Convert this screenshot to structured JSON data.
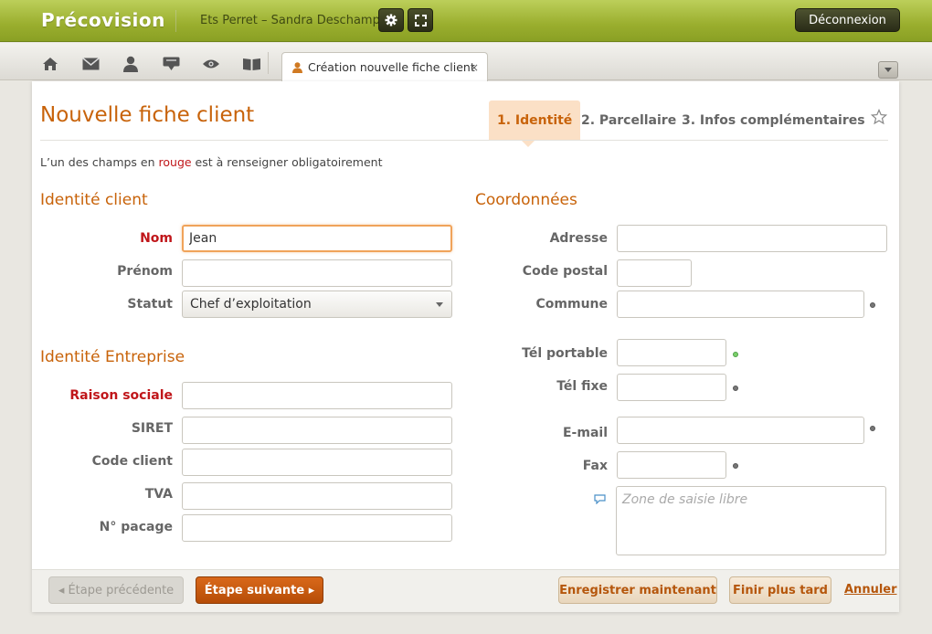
{
  "app": {
    "name": "Précovision",
    "user_context": "Ets Perret – Sandra Deschamps",
    "logout_label": "Déconnexion"
  },
  "topbar": {
    "settings_icon": "gear-icon",
    "fullscreen_icon": "expand-icon"
  },
  "nav": {
    "icons": [
      "home-icon",
      "mail-icon",
      "user-icon",
      "inbox-icon",
      "eye-icon",
      "book-icon"
    ],
    "open_tab": {
      "label": "Création nouvelle fiche client",
      "icon": "user-icon",
      "close": "×"
    }
  },
  "page": {
    "title": "Nouvelle fiche client",
    "steps": [
      {
        "label": "1. Identité",
        "active": true
      },
      {
        "label": "2. Parcellaire",
        "active": false
      },
      {
        "label": "3. Infos complémentaires",
        "active": false
      }
    ],
    "mandatory_prefix": "L’un des champs en ",
    "mandatory_red": "rouge",
    "mandatory_suffix": " est à renseigner obligatoirement"
  },
  "identite_client": {
    "title": "Identité client",
    "nom_label": "Nom",
    "nom_value": "Jean",
    "prenom_label": "Prénom",
    "prenom_value": "",
    "statut_label": "Statut",
    "statut_value": "Chef d’exploitation"
  },
  "identite_entreprise": {
    "title": "Identité Entreprise",
    "raison_label": "Raison sociale",
    "siret_label": "SIRET",
    "code_client_label": "Code client",
    "tva_label": "TVA",
    "pacage_label": "N° pacage"
  },
  "coordonnees": {
    "title": "Coordonnées",
    "adresse_label": "Adresse",
    "cp_label": "Code postal",
    "commune_label": "Commune",
    "tel_portable_label": "Tél portable",
    "tel_fixe_label": "Tél fixe",
    "email_label": "E-mail",
    "fax_label": "Fax",
    "notes_placeholder": "Zone de saisie libre"
  },
  "footer": {
    "prev_label": "◂ Étape précédente",
    "next_label": "Étape suivante ▸",
    "save_label": "Enregistrer maintenant",
    "later_label": "Finir plus tard",
    "cancel_label": "Annuler"
  },
  "colors": {
    "accent": "#c8630a",
    "required": "#c0161a",
    "brand_bar": "#9aae2e"
  }
}
